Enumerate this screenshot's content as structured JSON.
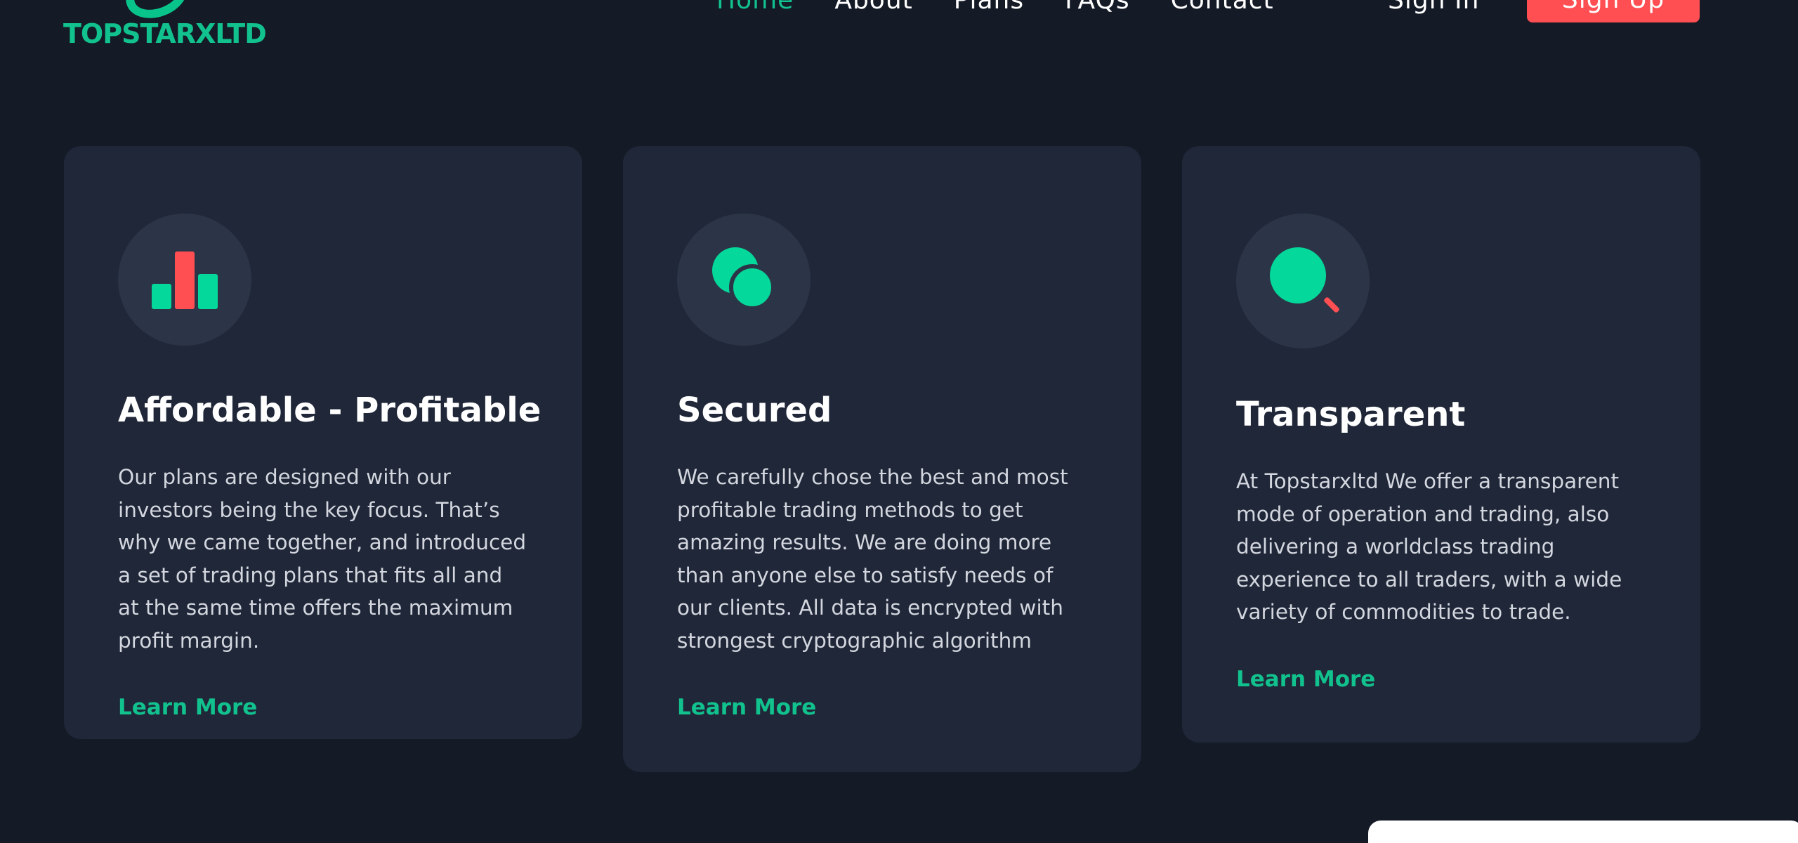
{
  "brand": {
    "name": "TOPSTARXLTD",
    "accent": "#12c28e",
    "danger": "#ff4f52"
  },
  "nav": {
    "items": [
      {
        "label": "Home",
        "active": true
      },
      {
        "label": "About",
        "active": false
      },
      {
        "label": "Plans",
        "active": false
      },
      {
        "label": "FAQs",
        "active": false
      },
      {
        "label": "Contact",
        "active": false
      }
    ],
    "signin_label": "Sign In",
    "signup_label": "Sign Up"
  },
  "features": [
    {
      "icon": "bar-chart-icon",
      "title": "Affordable - Profitable",
      "text": "Our plans are designed with our investors being the key focus. That’s why we came together, and introduced a set of trading plans that fits all and at the same time offers the maximum profit margin.",
      "link": "Learn More"
    },
    {
      "icon": "overlapping-circles-icon",
      "title": "Secured",
      "text": "We carefully chose the best and most profitable trading methods to get amazing results. We are doing more than anyone else to satisfy needs of our clients. All data is encrypted with strongest cryptographic algorithm",
      "link": "Learn More"
    },
    {
      "icon": "search-icon",
      "title": "Transparent",
      "text": "At Topstarxltd We offer a transparent mode of operation and trading, also delivering a worldclass trading experience to all traders, with a wide variety of commodities to trade.",
      "link": "Learn More"
    }
  ]
}
